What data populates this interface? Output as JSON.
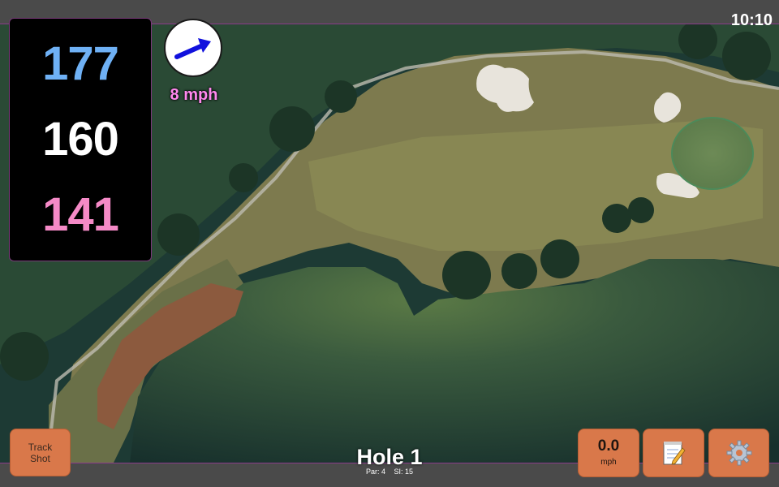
{
  "status": {
    "time": "10:10"
  },
  "distances": {
    "back": "177",
    "middle": "160",
    "front": "141"
  },
  "wind": {
    "speed": "8 mph",
    "direction_icon": "wind-arrow-icon"
  },
  "hole": {
    "title": "Hole 1",
    "par": "Par: 4",
    "si": "SI: 15"
  },
  "buttons": {
    "track_line1": "Track",
    "track_line2": "Shot",
    "speed_value": "0.0",
    "speed_unit": "mph",
    "notes_icon": "notepad-icon",
    "settings_icon": "gear-icon"
  },
  "colors": {
    "back": "#6fb1f5",
    "middle": "#ffffff",
    "front": "#f58ac7",
    "button": "#d9784a",
    "wind_text": "#ff88ee",
    "arrow": "#1111dd"
  }
}
